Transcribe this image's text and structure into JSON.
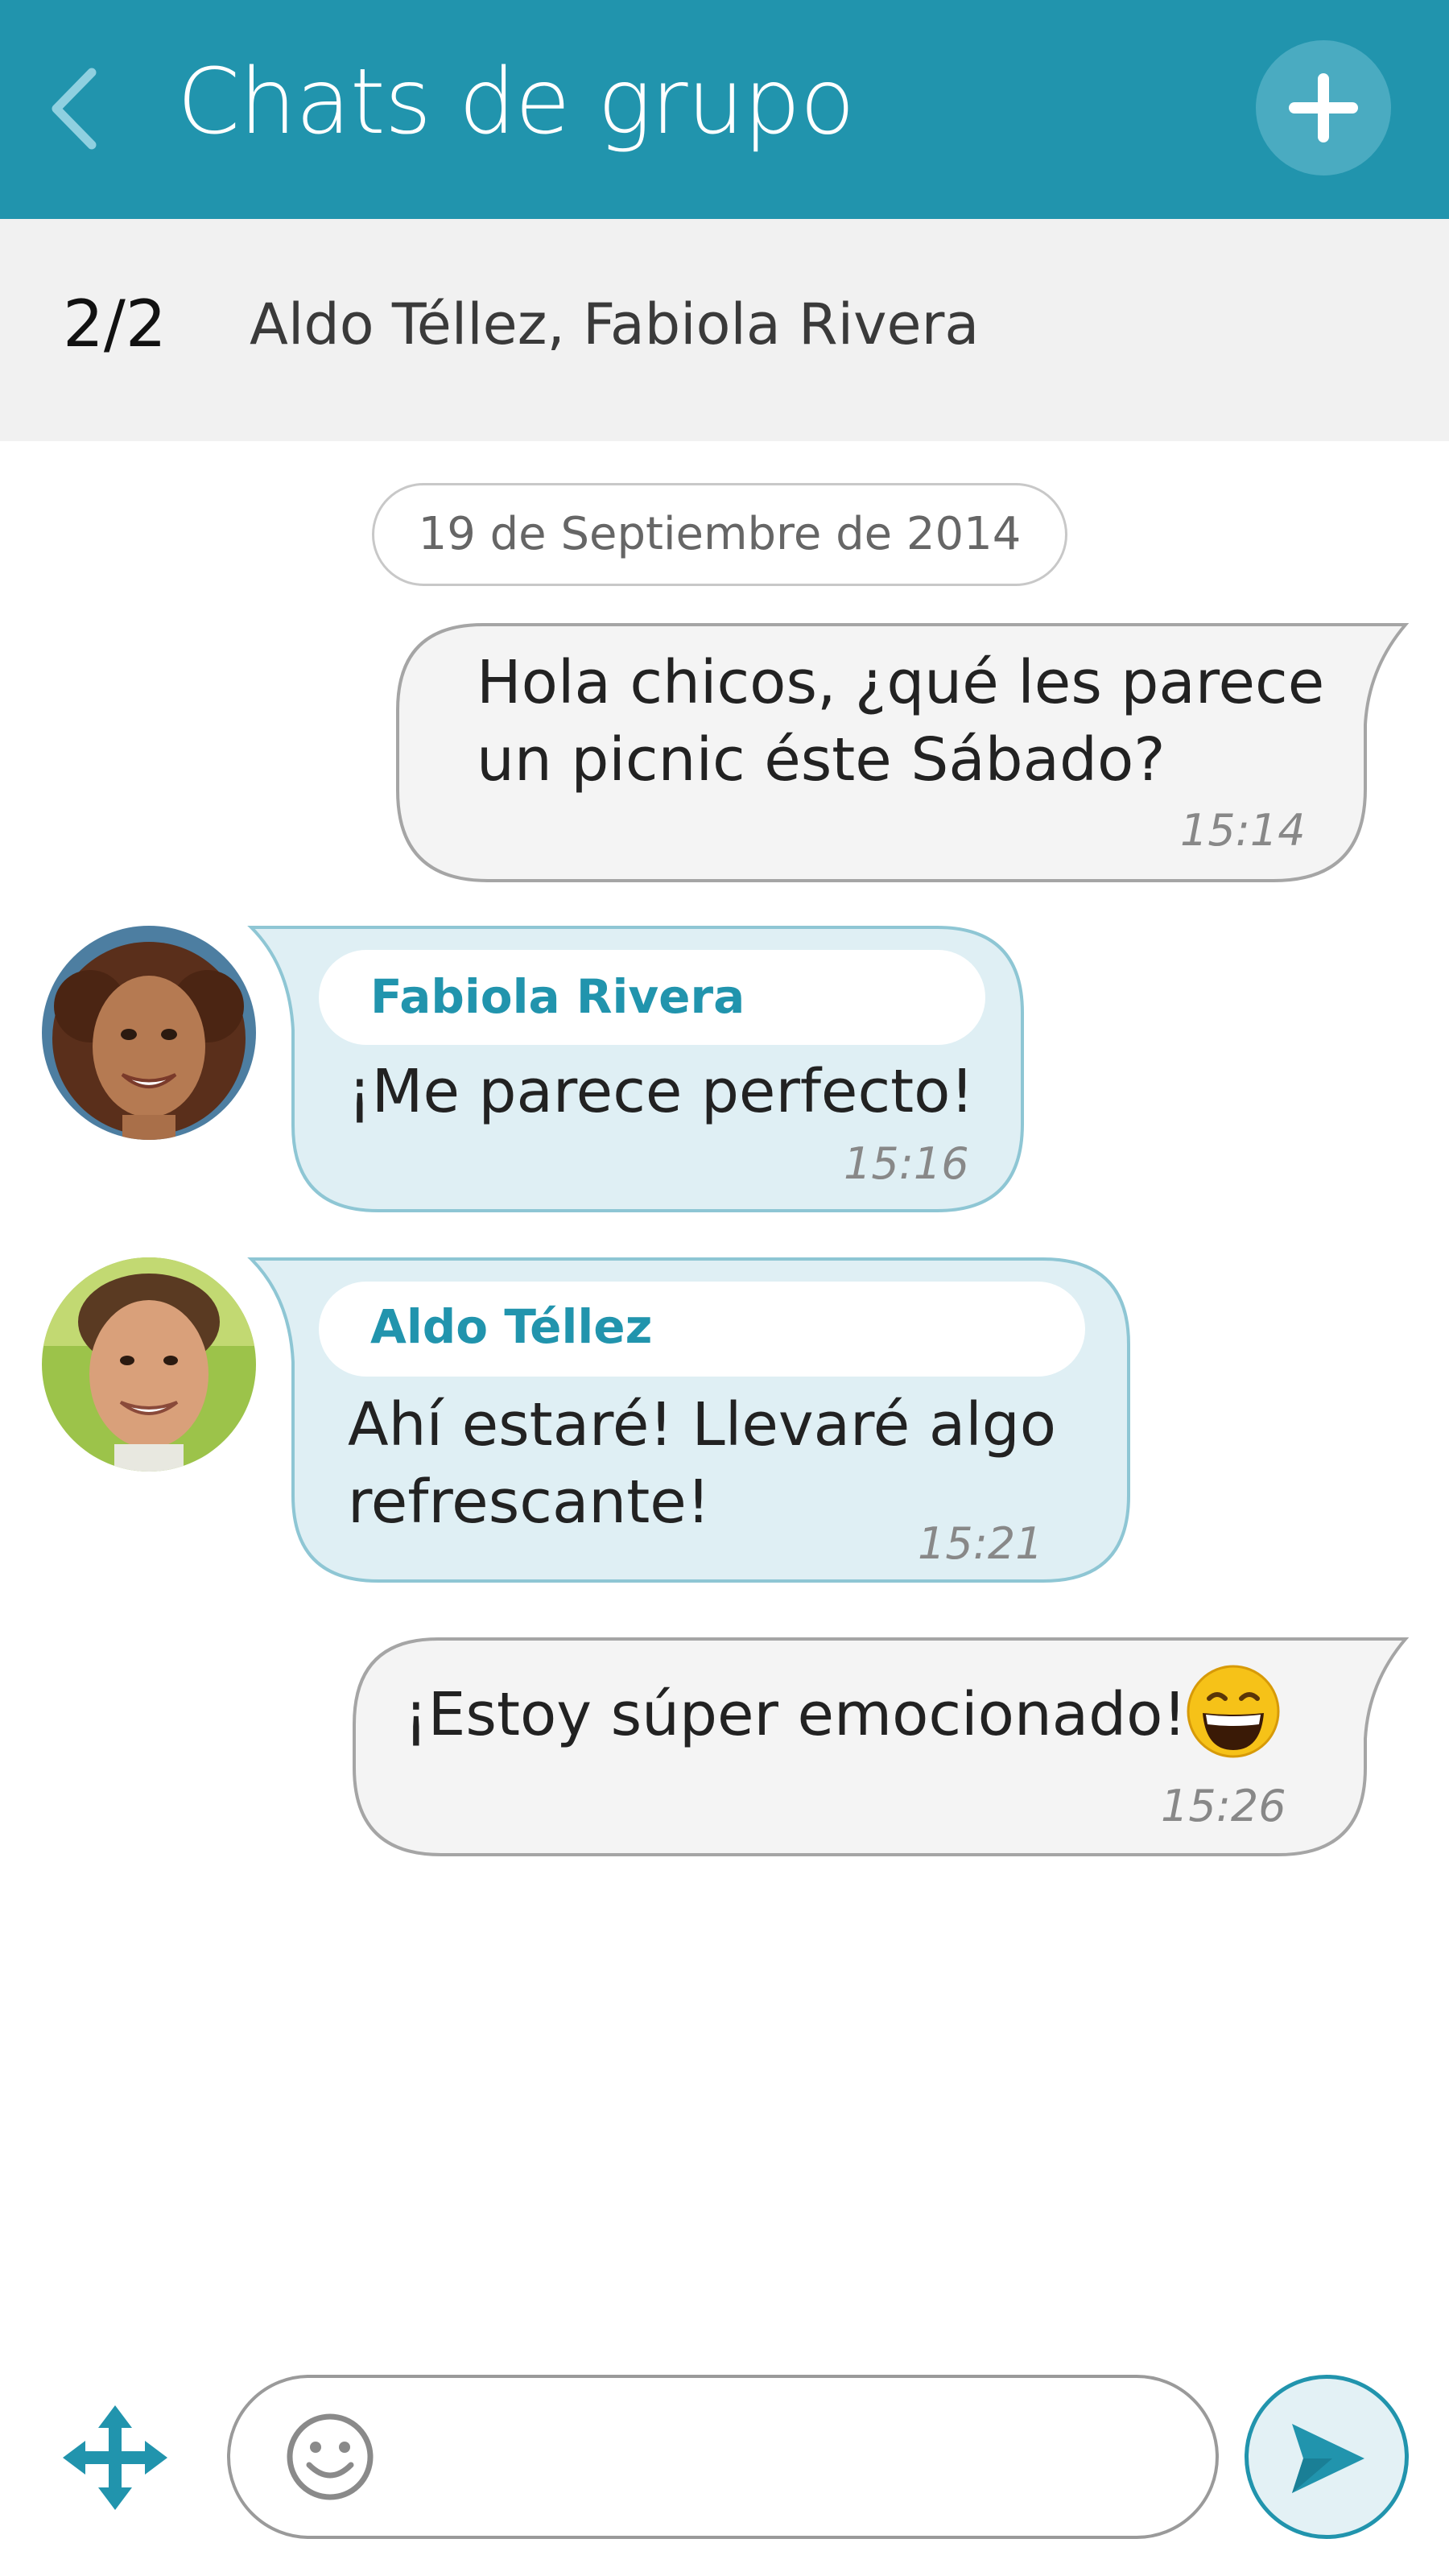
{
  "header": {
    "title": "Chats de grupo",
    "back_icon": "chevron-left-icon",
    "add_icon": "plus-icon"
  },
  "members": {
    "count": "2/2",
    "names": "Aldo Téllez, Fabiola Rivera"
  },
  "date_separator": "19 de Septiembre de 2014",
  "messages": [
    {
      "direction": "outgoing",
      "text_line1": "Hola chicos, ¿qué les parece",
      "text_line2": "un picnic éste Sábado?",
      "time": "15:14"
    },
    {
      "direction": "incoming",
      "sender": "Fabiola Rivera",
      "text": "¡Me parece perfecto!",
      "time": "15:16"
    },
    {
      "direction": "incoming",
      "sender": "Aldo Téllez",
      "text_line1": "Ahí estaré! Llevaré algo",
      "text_line2": "refrescante!",
      "time": "15:21"
    },
    {
      "direction": "outgoing",
      "text": "¡Estoy súper emocionado!",
      "emoji": "laughing-face-emoji",
      "time": "15:26"
    }
  ],
  "composer": {
    "placeholder": "",
    "emoji_icon": "smiley-icon",
    "attach_icon": "move-arrows-icon",
    "send_icon": "send-icon"
  },
  "colors": {
    "accent": "#2194ad",
    "incoming_bubble": "#dfeff4",
    "outgoing_bubble": "#f4f4f4",
    "members_bar": "#f1f1f1"
  }
}
